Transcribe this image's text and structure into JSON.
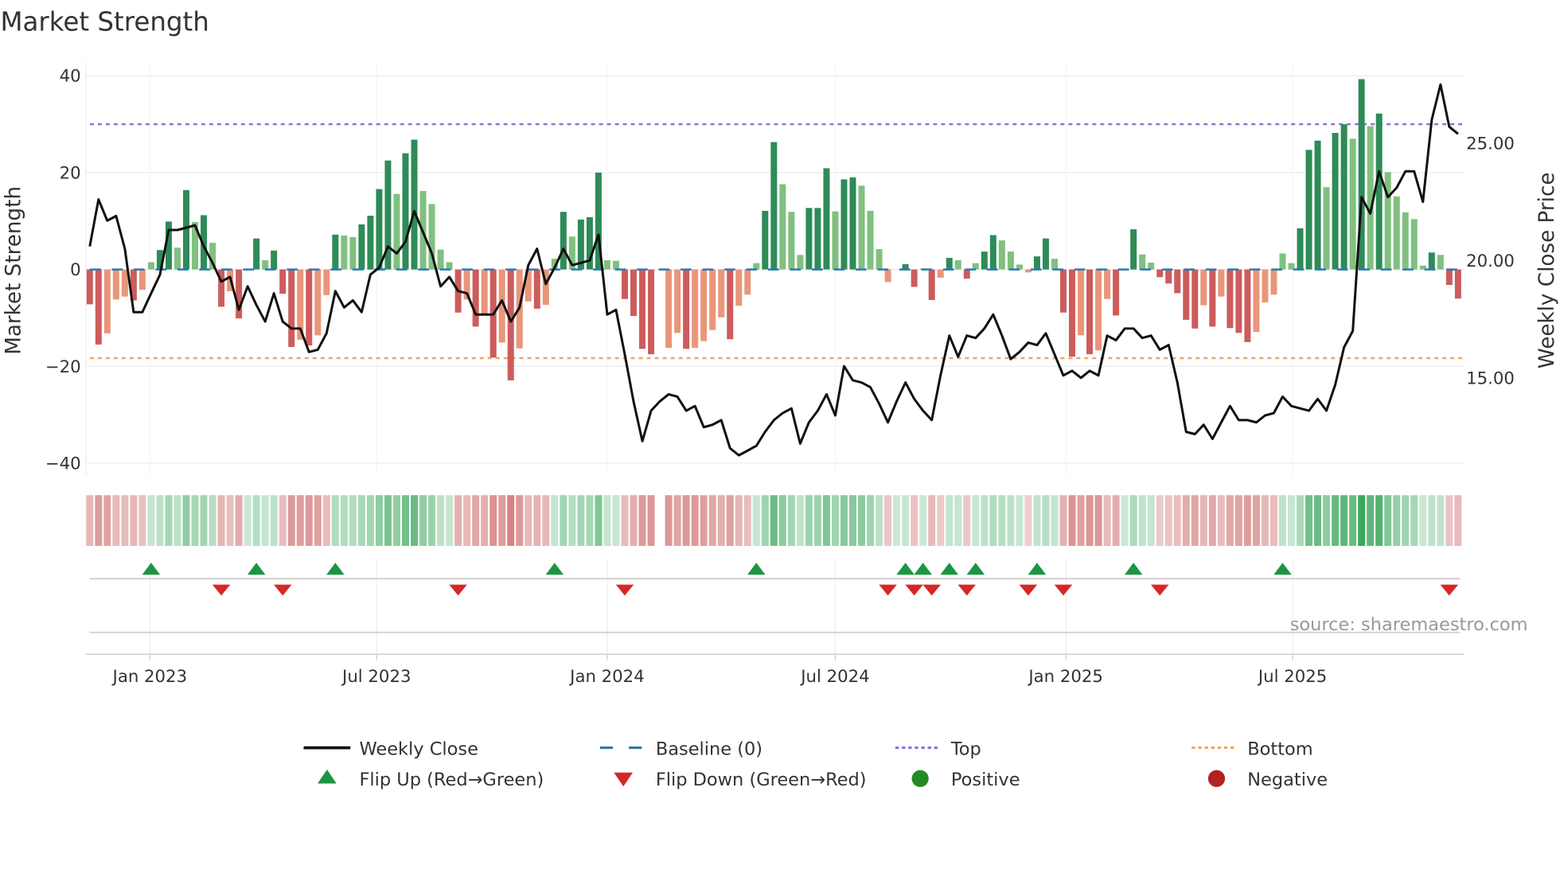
{
  "chart_data": {
    "type": "bar",
    "title": "Market Strength",
    "ylabel": "Market Strength",
    "y2label": "Weekly Close Price",
    "source": "source: sharemaestro.com",
    "frequency": "weekly",
    "start_date": "2022-11-14",
    "ylim": [
      -44,
      42
    ],
    "y_ticks": [
      40,
      20,
      0,
      -20,
      -40
    ],
    "y_tick_labels": [
      "40",
      "20",
      "0",
      "−20",
      "−40"
    ],
    "y2lim": [
      10.7,
      28.7
    ],
    "y2_ticks": [
      25,
      20,
      15
    ],
    "y2_tick_labels": [
      "25.00",
      "20.00",
      "15.00"
    ],
    "x_ticks": [
      {
        "date": "2023-01-01",
        "label": "Jan 2023"
      },
      {
        "date": "2023-07-01",
        "label": "Jul 2023"
      },
      {
        "date": "2024-01-01",
        "label": "Jan 2024"
      },
      {
        "date": "2024-07-01",
        "label": "Jul 2024"
      },
      {
        "date": "2025-01-01",
        "label": "Jan 2025"
      },
      {
        "date": "2025-07-01",
        "label": "Jul 2025"
      }
    ],
    "reference_lines": {
      "baseline": 0,
      "top": 30,
      "bottom": -18.3
    },
    "strength": [
      -7.2,
      -15.5,
      -13.2,
      -6.2,
      -5.6,
      -6.4,
      -4.2,
      1.5,
      4,
      9.9,
      4.5,
      16.4,
      9.8,
      11.2,
      5.5,
      -7.7,
      -4.5,
      -10.1,
      0,
      6.4,
      1.9,
      3.9,
      -5,
      -16,
      -14.5,
      -15.7,
      -13.6,
      -5.3,
      7.2,
      7,
      6.7,
      9.3,
      11.1,
      16.6,
      22.5,
      15.6,
      24,
      26.8,
      16.2,
      13.5,
      4.1,
      1.5,
      -8.9,
      -6.2,
      -11.8,
      -9.4,
      -18.2,
      -15.1,
      -22.9,
      -16.3,
      -6.6,
      -8.1,
      -7.3,
      2.2,
      11.9,
      6.8,
      10.3,
      10.8,
      20,
      1.9,
      1.8,
      -6.1,
      -9.6,
      -16.4,
      -17.5,
      null,
      -16.2,
      -13.1,
      -16.4,
      -16.2,
      -14.8,
      -12.5,
      -9.9,
      -14.4,
      -7.5,
      -5.2,
      1.3,
      12.1,
      26.3,
      17.6,
      11.9,
      3.0,
      12.7,
      12.7,
      20.9,
      12.0,
      18.6,
      19.0,
      17.3,
      12.1,
      4.2,
      -2.6,
      0,
      1.1,
      -3.6,
      0.2,
      -6.3,
      -1.7,
      2.4,
      1.9,
      -1.9,
      1.3,
      3.7,
      7.1,
      6.0,
      3.7,
      1.0,
      -0.6,
      2.7,
      6.4,
      2.2,
      -8.9,
      -18,
      -13.6,
      -17.5,
      -16.7,
      -6.1,
      -9.5,
      0,
      8.3,
      3.1,
      1.4,
      -1.6,
      -2.9,
      -4.9,
      -10.4,
      -12.2,
      -7.4,
      -11.8,
      -5.6,
      -12.1,
      -13.1,
      -15.0,
      -12.9,
      -6.8,
      -5.2,
      3.3,
      1.3,
      8.5,
      24.7,
      26.6,
      17.0,
      28.2,
      30.0,
      27.0,
      39.3,
      29.6,
      32.2,
      20.1,
      15.1,
      11.8,
      10.4,
      0.8,
      3.5,
      3.0,
      -3.2,
      -6.0
    ],
    "weekly_close": [
      20.6,
      22.6,
      21.7,
      21.9,
      20.5,
      17.8,
      17.8,
      18.6,
      19.4,
      21.3,
      21.3,
      21.4,
      21.5,
      20.6,
      19.9,
      19.1,
      19.3,
      17.9,
      18.9,
      18.1,
      17.4,
      18.6,
      17.4,
      17.1,
      17.1,
      16.1,
      16.2,
      16.9,
      18.7,
      18.0,
      18.3,
      17.8,
      19.4,
      19.7,
      20.6,
      20.3,
      20.8,
      22.1,
      21.2,
      20.3,
      18.9,
      19.3,
      18.7,
      18.6,
      17.7,
      17.7,
      17.7,
      18.3,
      17.4,
      18.0,
      19.8,
      20.5,
      19.0,
      19.7,
      20.5,
      19.8,
      19.9,
      20.0,
      21.1,
      17.7,
      17.9,
      16.0,
      14.0,
      12.3,
      13.6,
      14.0,
      14.3,
      14.2,
      13.6,
      13.8,
      12.9,
      13.0,
      13.2,
      12.0,
      11.7,
      11.9,
      12.1,
      12.7,
      13.2,
      13.5,
      13.7,
      12.2,
      13.1,
      13.6,
      14.3,
      13.4,
      15.5,
      14.9,
      14.8,
      14.6,
      13.9,
      13.1,
      14.0,
      14.8,
      14.1,
      13.6,
      13.2,
      15.1,
      16.8,
      15.9,
      16.8,
      16.7,
      17.1,
      17.7,
      16.8,
      15.8,
      16.1,
      16.5,
      16.4,
      16.9,
      16.0,
      15.1,
      15.3,
      15.0,
      15.3,
      15.1,
      16.8,
      16.6,
      17.1,
      17.1,
      16.7,
      16.8,
      16.2,
      16.4,
      14.8,
      12.7,
      12.6,
      13.0,
      12.4,
      13.1,
      13.8,
      13.2,
      13.2,
      13.1,
      13.4,
      13.5,
      14.2,
      13.8,
      13.7,
      13.6,
      14.1,
      13.6,
      14.7,
      16.3,
      17.0,
      22.7,
      22.0,
      23.8,
      22.7,
      23.1,
      23.8,
      23.8,
      22.5,
      26.0,
      27.5,
      25.7,
      25.4
    ],
    "flip_up_dates": [
      "2023-01-02",
      "2023-03-27",
      "2023-05-29",
      "2023-11-20",
      "2024-04-29",
      "2024-08-26",
      "2024-09-09",
      "2024-09-30",
      "2024-10-21",
      "2024-12-09",
      "2025-02-24",
      "2025-06-23"
    ],
    "flip_down_dates": [
      "2023-02-27",
      "2023-04-17",
      "2023-09-04",
      "2024-01-15",
      "2024-08-12",
      "2024-09-02",
      "2024-09-16",
      "2024-10-14",
      "2024-12-02",
      "2024-12-30",
      "2025-03-17",
      "2025-11-03"
    ],
    "legend": [
      {
        "key": "close",
        "label": "Weekly Close"
      },
      {
        "key": "baseline",
        "label": "Baseline (0)"
      },
      {
        "key": "top",
        "label": "Top"
      },
      {
        "key": "bottom",
        "label": "Bottom"
      },
      {
        "key": "flip_up",
        "label": "Flip Up (Red→Green)"
      },
      {
        "key": "flip_down",
        "label": "Flip Down (Green→Red)"
      },
      {
        "key": "positive",
        "label": "Positive"
      },
      {
        "key": "negative",
        "label": "Negative"
      }
    ],
    "legend_position": "bottom-center",
    "colors": {
      "pos_strong": "#2e8b57",
      "pos_weak": "#80c080",
      "neg_strong": "#cd5c5c",
      "neg_weak": "#e9967a",
      "heat_pos": "#31a354",
      "heat_neg": "#c85a5a",
      "close": "#111111",
      "baseline": "#2a7ab0",
      "top": "#9370db",
      "bottom": "#f4a460",
      "flip_up": "#1a9641",
      "flip_down": "#d62728",
      "positive": "#228b22",
      "negative": "#b22222",
      "grid": "#ececec"
    }
  }
}
